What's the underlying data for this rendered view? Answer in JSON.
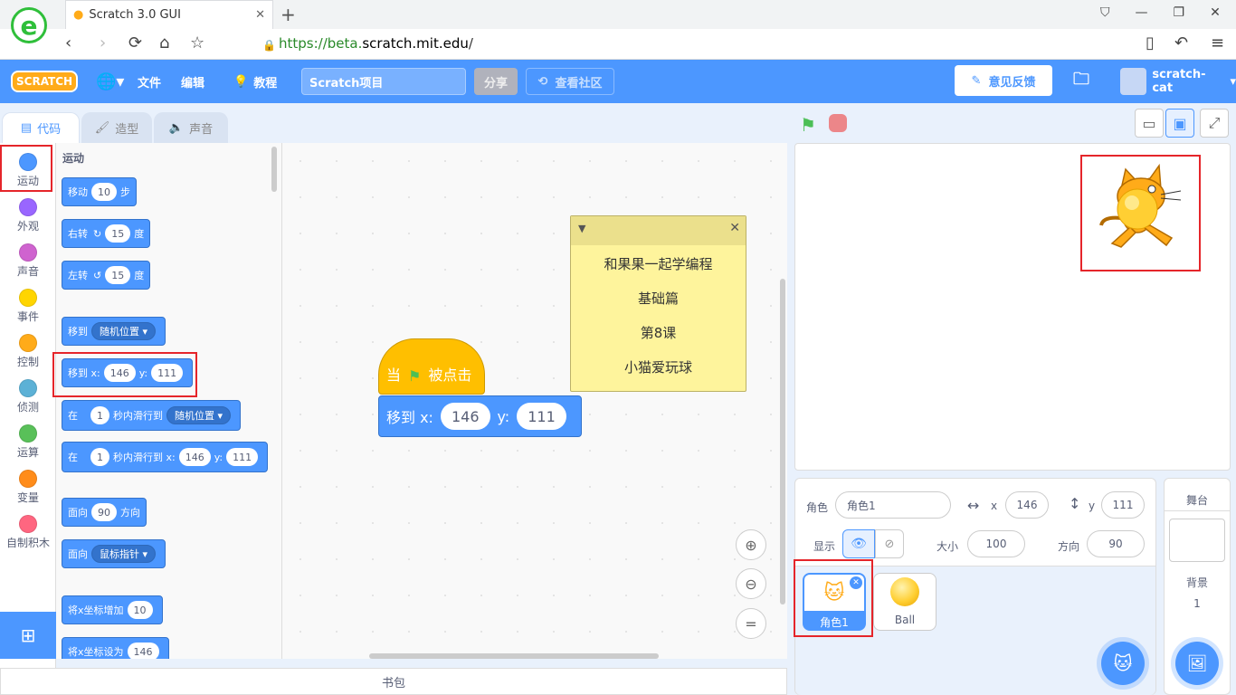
{
  "browser": {
    "tab_title": "Scratch 3.0 GUI",
    "url_prefix": "https://beta.",
    "url_domain": "scratch.mit.edu",
    "url_suffix": "/"
  },
  "menu": {
    "logo": "SCRATCH",
    "file": "文件",
    "edit": "编辑",
    "tutorials": "教程",
    "project_title": "Scratch项目",
    "share": "分享",
    "see_community": "查看社区",
    "feedback": "意见反馈",
    "username": "scratch-cat"
  },
  "tabs": {
    "code": "代码",
    "costumes": "造型",
    "sounds": "声音"
  },
  "categories": [
    {
      "label": "运动",
      "color": "#4c97ff"
    },
    {
      "label": "外观",
      "color": "#9966ff"
    },
    {
      "label": "声音",
      "color": "#cf63cf"
    },
    {
      "label": "事件",
      "color": "#ffd500"
    },
    {
      "label": "控制",
      "color": "#ffab19"
    },
    {
      "label": "侦测",
      "color": "#5cb1d6"
    },
    {
      "label": "运算",
      "color": "#59c059"
    },
    {
      "label": "变量",
      "color": "#ff8c1a"
    },
    {
      "label": "自制积木",
      "color": "#ff6680"
    }
  ],
  "palette": {
    "heading": "运动",
    "move": {
      "a": "移动",
      "n": "10",
      "b": "步"
    },
    "turn_right": {
      "a": "右转",
      "n": "15",
      "b": "度"
    },
    "turn_left": {
      "a": "左转",
      "n": "15",
      "b": "度"
    },
    "goto": {
      "a": "移到",
      "d": "随机位置"
    },
    "goto_xy": {
      "a": "移到 x:",
      "x": "146",
      "y_label": "y:",
      "y": "111"
    },
    "glide": {
      "a": "在",
      "n": "1",
      "b": "秒内滑行到",
      "d": "随机位置"
    },
    "glide_xy": {
      "a": "在",
      "n": "1",
      "b": "秒内滑行到 x:",
      "x": "146",
      "y_label": "y:",
      "y": "111"
    },
    "point_dir": {
      "a": "面向",
      "n": "90",
      "b": "方向"
    },
    "point_towards": {
      "a": "面向",
      "d": "鼠标指针"
    },
    "change_x": {
      "a": "将x坐标增加",
      "n": "10"
    },
    "set_x": {
      "a": "将x坐标设为",
      "n": "146"
    }
  },
  "script": {
    "hat_a": "当",
    "hat_b": "被点击",
    "goto_a": "移到 x:",
    "x": "146",
    "y_label": "y:",
    "y": "111"
  },
  "note": {
    "line1": "和果果一起学编程",
    "line2": "基础篇",
    "line3": "第8课",
    "line4": "小猫爱玩球"
  },
  "backpack": "书包",
  "sprite_info": {
    "sprite_label": "角色",
    "sprite_name": "角色1",
    "x_label": "x",
    "x": "146",
    "y_label": "y",
    "y": "111",
    "show_label": "显示",
    "size_label": "大小",
    "size": "100",
    "direction_label": "方向",
    "direction": "90"
  },
  "sprites": [
    {
      "name": "角色1",
      "selected": true
    },
    {
      "name": "Ball",
      "selected": false
    }
  ],
  "stage_panel": {
    "title": "舞台",
    "backdrops_label": "背景",
    "backdrops_count": "1"
  }
}
